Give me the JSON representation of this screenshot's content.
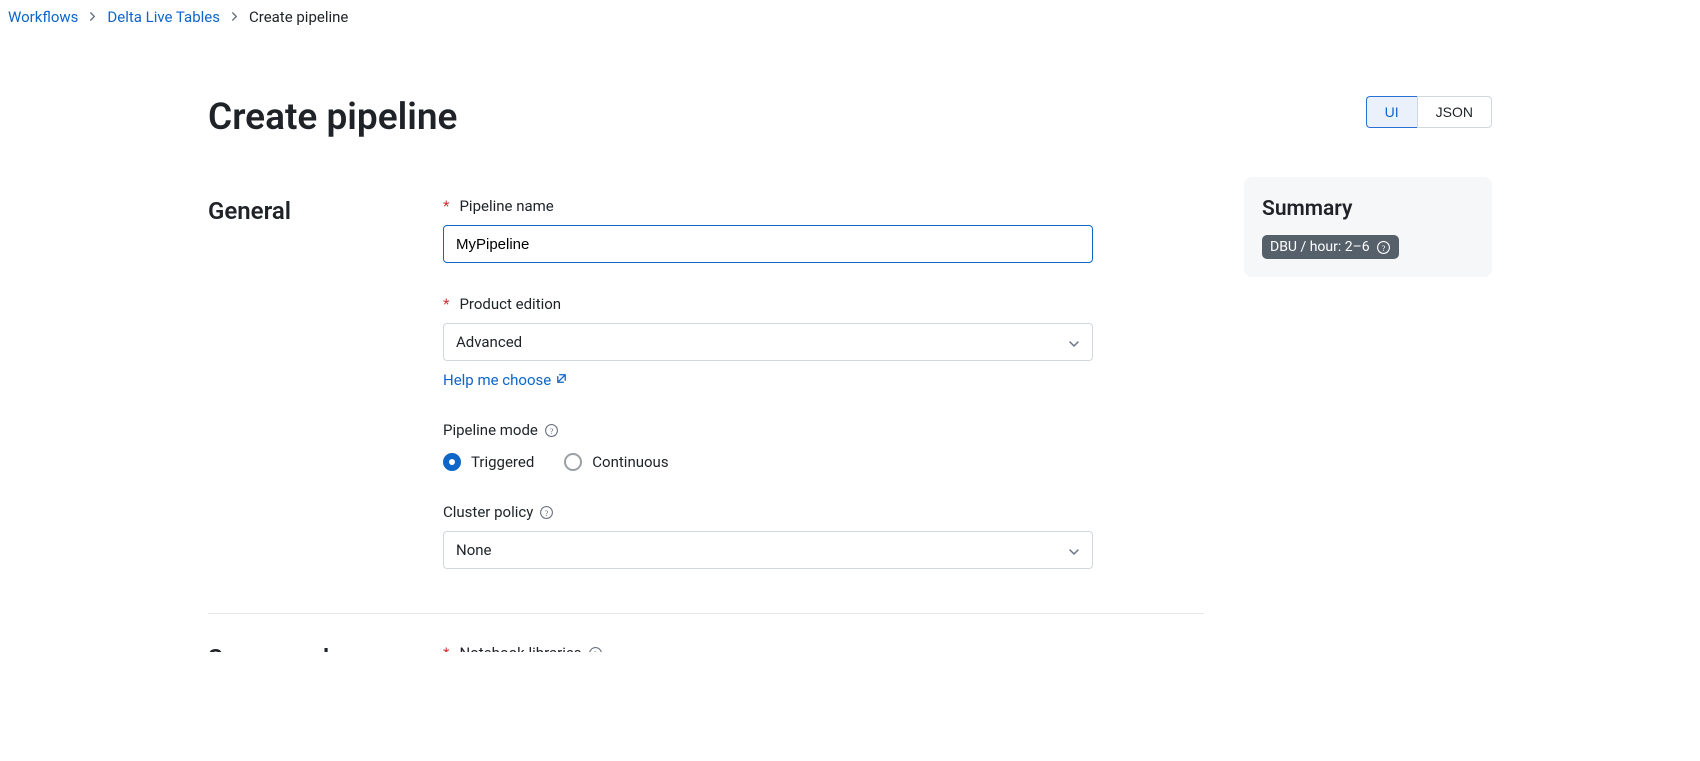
{
  "breadcrumbs": {
    "workflows": "Workflows",
    "dlt": "Delta Live Tables",
    "current": "Create pipeline"
  },
  "page_title": "Create pipeline",
  "view_toggle": {
    "ui": "UI",
    "json": "JSON"
  },
  "sections": {
    "general": {
      "title": "General",
      "pipeline_name_label": "Pipeline name",
      "pipeline_name_value": "MyPipeline",
      "product_edition_label": "Product edition",
      "product_edition_value": "Advanced",
      "help_link": "Help me choose",
      "pipeline_mode_label": "Pipeline mode",
      "mode_triggered": "Triggered",
      "mode_continuous": "Continuous",
      "cluster_policy_label": "Cluster policy",
      "cluster_policy_value": "None"
    },
    "source_code": {
      "title": "Source code",
      "notebook_label": "Notebook libraries"
    }
  },
  "summary": {
    "title": "Summary",
    "dbu_badge": "DBU / hour: 2–6"
  }
}
